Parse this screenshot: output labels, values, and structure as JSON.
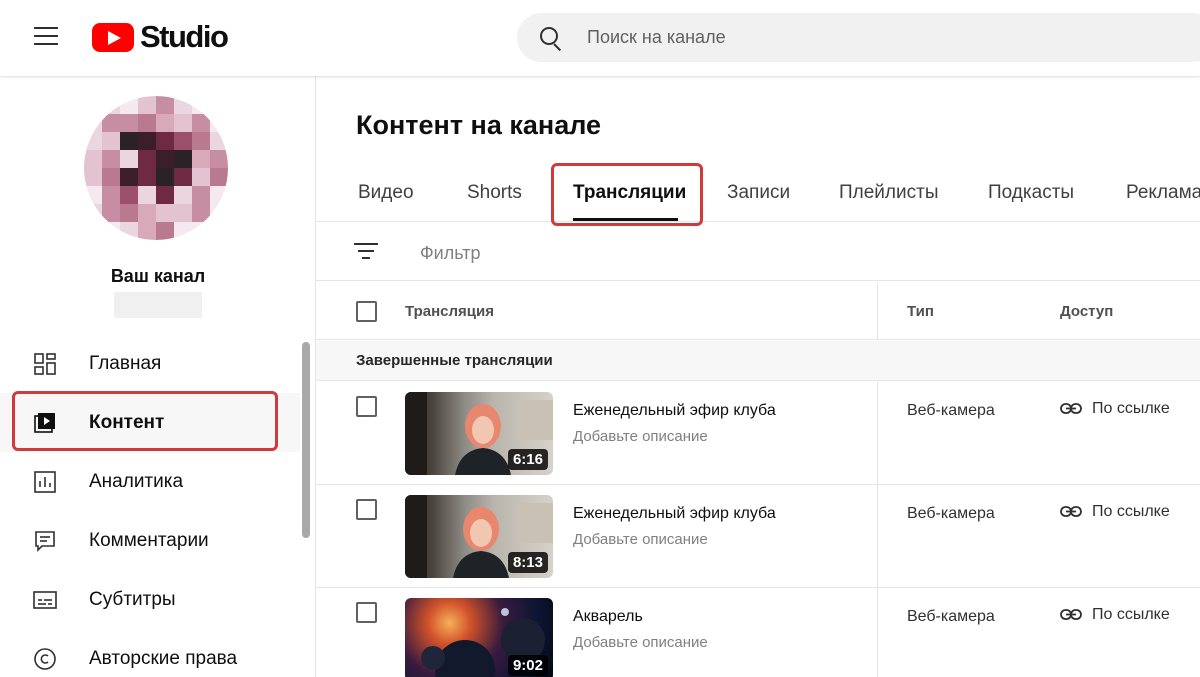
{
  "header": {
    "logo_text": "Studio",
    "search_placeholder": "Поиск на канале"
  },
  "sidebar": {
    "channel_name": "Ваш канал",
    "items": [
      {
        "label": "Главная",
        "icon": "dashboard-icon"
      },
      {
        "label": "Контент",
        "icon": "content-play-icon",
        "active": true
      },
      {
        "label": "Аналитика",
        "icon": "analytics-icon"
      },
      {
        "label": "Комментарии",
        "icon": "comments-icon"
      },
      {
        "label": "Субтитры",
        "icon": "subtitles-icon"
      },
      {
        "label": "Авторские права",
        "icon": "copyright-icon"
      }
    ]
  },
  "main": {
    "title": "Контент на канале",
    "tabs": [
      {
        "label": "Видео"
      },
      {
        "label": "Shorts"
      },
      {
        "label": "Трансляции",
        "active": true
      },
      {
        "label": "Записи"
      },
      {
        "label": "Плейлисты"
      },
      {
        "label": "Подкасты"
      },
      {
        "label": "Реклама"
      }
    ],
    "filter_label": "Фильтр",
    "columns": {
      "stream": "Трансляция",
      "type": "Тип",
      "access": "Доступ"
    },
    "section_label": "Завершенные трансляции",
    "rows": [
      {
        "title": "Еженедельный эфир клуба",
        "description": "Добавьте описание",
        "duration": "6:16",
        "type": "Веб-камера",
        "access": "По ссылке"
      },
      {
        "title": "Еженедельный эфир клуба",
        "description": "Добавьте описание",
        "duration": "8:13",
        "type": "Веб-камера",
        "access": "По ссылке"
      },
      {
        "title": "Акварель",
        "description": "Добавьте описание",
        "duration": "9:02",
        "type": "Веб-камера",
        "access": "По ссылке"
      }
    ]
  },
  "colors": {
    "brand_red": "#ff0000",
    "highlight_red": "#d13a3a"
  }
}
